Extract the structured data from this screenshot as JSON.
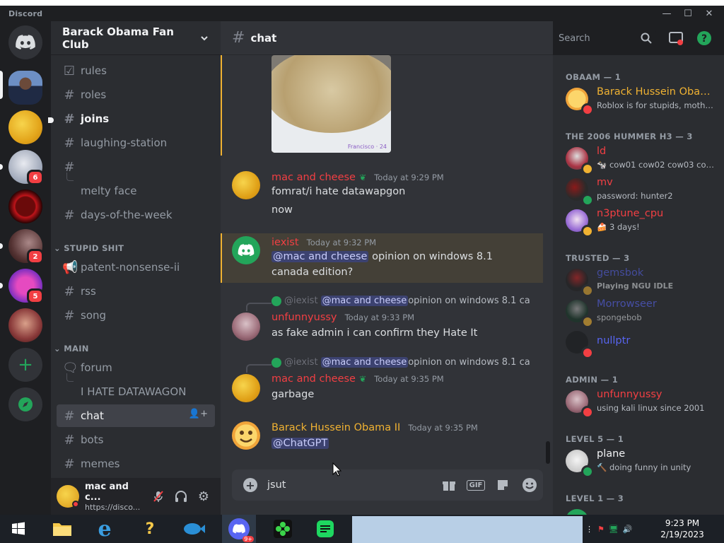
{
  "window": {
    "app_name": "Discord",
    "minimize": "—",
    "maximize": "☐",
    "close": "✕"
  },
  "server": {
    "name": "Barack Obama Fan Club"
  },
  "guild_badges": [
    "6",
    "2",
    "5"
  ],
  "channels": {
    "items": [
      {
        "name": "rules"
      },
      {
        "name": "roles"
      },
      {
        "name": "joins"
      },
      {
        "name": "laughing-station"
      },
      {
        "name": ""
      },
      {
        "name": "melty face"
      },
      {
        "name": "days-of-the-week"
      },
      {
        "name": "patent-nonsense-ii"
      },
      {
        "name": "rss"
      },
      {
        "name": "song"
      },
      {
        "name": "forum"
      },
      {
        "name": "I HATE DATAWAGON"
      },
      {
        "name": "chat"
      },
      {
        "name": "bots"
      },
      {
        "name": "memes"
      }
    ],
    "categories": [
      "STUPID SHIT",
      "MAIN"
    ]
  },
  "user_panel": {
    "name": "mac and c...",
    "status": "https://disco..."
  },
  "chat": {
    "channel_name": "chat",
    "search_placeholder": "Search",
    "image_caption": "Francisco · 24",
    "messages": [
      {
        "author": "mac and cheese",
        "time": "Today at 9:29 PM",
        "lines": [
          "fomrat/i hate datawapgon",
          "now"
        ]
      },
      {
        "author": "iexist",
        "time": "Today at 9:32 PM",
        "mention": "@mac and cheese",
        "lines": [
          " opinion on windows 8.1",
          "canada edition?"
        ]
      },
      {
        "reply_author": "@iexist",
        "reply_mention": "@mac and cheese",
        "reply_text": " opinion on windows 8.1 ca",
        "author": "unfunnyussy",
        "time": "Today at 9:33 PM",
        "lines": [
          "as fake admin i can confirm they Hate It"
        ]
      },
      {
        "reply_author": "@iexist",
        "reply_mention": "@mac and cheese",
        "reply_text": " opinion on windows 8.1 ca",
        "author": "mac and cheese",
        "time": "Today at 9:35 PM",
        "lines": [
          "garbage"
        ]
      },
      {
        "author": "Barack Hussein Obama II",
        "time": "Today at 9:35 PM",
        "mention": "@ChatGPT",
        "lines": [
          ""
        ]
      }
    ],
    "composer_value": "jsut"
  },
  "members": {
    "groups": [
      {
        "label": "OBAAM — 1",
        "members": [
          {
            "name": "Barack Hussein Obam...",
            "status": "Roblox is for stupids, motherf..."
          }
        ]
      },
      {
        "label": "THE 2006 HUMMER H3 — 3",
        "members": [
          {
            "name": "ld",
            "status": "cow01 cow02 cow03 cow..."
          },
          {
            "name": "mv",
            "status": "password: hunter2"
          },
          {
            "name": "n3ptune_cpu",
            "status": "3 days!"
          }
        ]
      },
      {
        "label": "TRUSTED — 3",
        "members": [
          {
            "name": "gemsbok",
            "status": "Playing NGU IDLE"
          },
          {
            "name": "Morrowseer",
            "status": "spongebob"
          },
          {
            "name": "nullptr",
            "status": ""
          }
        ]
      },
      {
        "label": "ADMIN — 1",
        "members": [
          {
            "name": "unfunnyussy",
            "status": "using kali linux since 2001"
          }
        ]
      },
      {
        "label": "LEVEL 5 — 1",
        "members": [
          {
            "name": "plane",
            "status": "doing funny in unity"
          }
        ]
      },
      {
        "label": "LEVEL 1 — 3",
        "members": []
      }
    ]
  },
  "taskbar": {
    "time": "9:23 PM",
    "date": "2/19/2023",
    "discord_badge": "9+"
  },
  "colors": {
    "yellow_name": "#f0b232",
    "red_name": "#f23f43",
    "blurple": "#5865f2",
    "green": "#23a55a"
  }
}
